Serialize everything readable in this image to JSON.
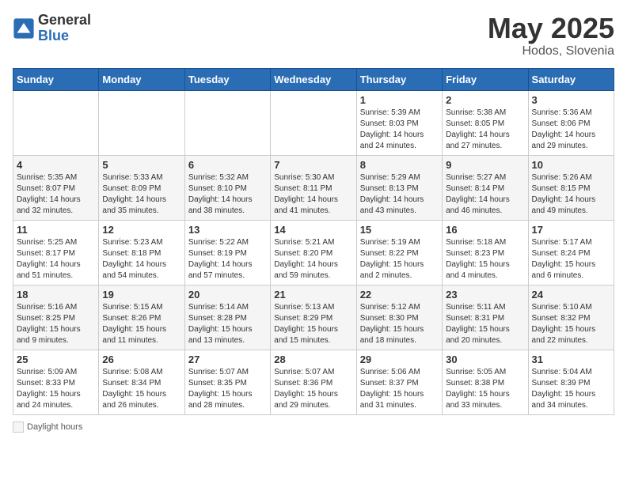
{
  "header": {
    "logo_general": "General",
    "logo_blue": "Blue",
    "month_title": "May 2025",
    "location": "Hodos, Slovenia"
  },
  "days_of_week": [
    "Sunday",
    "Monday",
    "Tuesday",
    "Wednesday",
    "Thursday",
    "Friday",
    "Saturday"
  ],
  "weeks": [
    [
      {
        "day": "",
        "sunrise": "",
        "sunset": "",
        "daylight": ""
      },
      {
        "day": "",
        "sunrise": "",
        "sunset": "",
        "daylight": ""
      },
      {
        "day": "",
        "sunrise": "",
        "sunset": "",
        "daylight": ""
      },
      {
        "day": "",
        "sunrise": "",
        "sunset": "",
        "daylight": ""
      },
      {
        "day": "1",
        "sunrise": "Sunrise: 5:39 AM",
        "sunset": "Sunset: 8:03 PM",
        "daylight": "Daylight: 14 hours and 24 minutes."
      },
      {
        "day": "2",
        "sunrise": "Sunrise: 5:38 AM",
        "sunset": "Sunset: 8:05 PM",
        "daylight": "Daylight: 14 hours and 27 minutes."
      },
      {
        "day": "3",
        "sunrise": "Sunrise: 5:36 AM",
        "sunset": "Sunset: 8:06 PM",
        "daylight": "Daylight: 14 hours and 29 minutes."
      }
    ],
    [
      {
        "day": "4",
        "sunrise": "Sunrise: 5:35 AM",
        "sunset": "Sunset: 8:07 PM",
        "daylight": "Daylight: 14 hours and 32 minutes."
      },
      {
        "day": "5",
        "sunrise": "Sunrise: 5:33 AM",
        "sunset": "Sunset: 8:09 PM",
        "daylight": "Daylight: 14 hours and 35 minutes."
      },
      {
        "day": "6",
        "sunrise": "Sunrise: 5:32 AM",
        "sunset": "Sunset: 8:10 PM",
        "daylight": "Daylight: 14 hours and 38 minutes."
      },
      {
        "day": "7",
        "sunrise": "Sunrise: 5:30 AM",
        "sunset": "Sunset: 8:11 PM",
        "daylight": "Daylight: 14 hours and 41 minutes."
      },
      {
        "day": "8",
        "sunrise": "Sunrise: 5:29 AM",
        "sunset": "Sunset: 8:13 PM",
        "daylight": "Daylight: 14 hours and 43 minutes."
      },
      {
        "day": "9",
        "sunrise": "Sunrise: 5:27 AM",
        "sunset": "Sunset: 8:14 PM",
        "daylight": "Daylight: 14 hours and 46 minutes."
      },
      {
        "day": "10",
        "sunrise": "Sunrise: 5:26 AM",
        "sunset": "Sunset: 8:15 PM",
        "daylight": "Daylight: 14 hours and 49 minutes."
      }
    ],
    [
      {
        "day": "11",
        "sunrise": "Sunrise: 5:25 AM",
        "sunset": "Sunset: 8:17 PM",
        "daylight": "Daylight: 14 hours and 51 minutes."
      },
      {
        "day": "12",
        "sunrise": "Sunrise: 5:23 AM",
        "sunset": "Sunset: 8:18 PM",
        "daylight": "Daylight: 14 hours and 54 minutes."
      },
      {
        "day": "13",
        "sunrise": "Sunrise: 5:22 AM",
        "sunset": "Sunset: 8:19 PM",
        "daylight": "Daylight: 14 hours and 57 minutes."
      },
      {
        "day": "14",
        "sunrise": "Sunrise: 5:21 AM",
        "sunset": "Sunset: 8:20 PM",
        "daylight": "Daylight: 14 hours and 59 minutes."
      },
      {
        "day": "15",
        "sunrise": "Sunrise: 5:19 AM",
        "sunset": "Sunset: 8:22 PM",
        "daylight": "Daylight: 15 hours and 2 minutes."
      },
      {
        "day": "16",
        "sunrise": "Sunrise: 5:18 AM",
        "sunset": "Sunset: 8:23 PM",
        "daylight": "Daylight: 15 hours and 4 minutes."
      },
      {
        "day": "17",
        "sunrise": "Sunrise: 5:17 AM",
        "sunset": "Sunset: 8:24 PM",
        "daylight": "Daylight: 15 hours and 6 minutes."
      }
    ],
    [
      {
        "day": "18",
        "sunrise": "Sunrise: 5:16 AM",
        "sunset": "Sunset: 8:25 PM",
        "daylight": "Daylight: 15 hours and 9 minutes."
      },
      {
        "day": "19",
        "sunrise": "Sunrise: 5:15 AM",
        "sunset": "Sunset: 8:26 PM",
        "daylight": "Daylight: 15 hours and 11 minutes."
      },
      {
        "day": "20",
        "sunrise": "Sunrise: 5:14 AM",
        "sunset": "Sunset: 8:28 PM",
        "daylight": "Daylight: 15 hours and 13 minutes."
      },
      {
        "day": "21",
        "sunrise": "Sunrise: 5:13 AM",
        "sunset": "Sunset: 8:29 PM",
        "daylight": "Daylight: 15 hours and 15 minutes."
      },
      {
        "day": "22",
        "sunrise": "Sunrise: 5:12 AM",
        "sunset": "Sunset: 8:30 PM",
        "daylight": "Daylight: 15 hours and 18 minutes."
      },
      {
        "day": "23",
        "sunrise": "Sunrise: 5:11 AM",
        "sunset": "Sunset: 8:31 PM",
        "daylight": "Daylight: 15 hours and 20 minutes."
      },
      {
        "day": "24",
        "sunrise": "Sunrise: 5:10 AM",
        "sunset": "Sunset: 8:32 PM",
        "daylight": "Daylight: 15 hours and 22 minutes."
      }
    ],
    [
      {
        "day": "25",
        "sunrise": "Sunrise: 5:09 AM",
        "sunset": "Sunset: 8:33 PM",
        "daylight": "Daylight: 15 hours and 24 minutes."
      },
      {
        "day": "26",
        "sunrise": "Sunrise: 5:08 AM",
        "sunset": "Sunset: 8:34 PM",
        "daylight": "Daylight: 15 hours and 26 minutes."
      },
      {
        "day": "27",
        "sunrise": "Sunrise: 5:07 AM",
        "sunset": "Sunset: 8:35 PM",
        "daylight": "Daylight: 15 hours and 28 minutes."
      },
      {
        "day": "28",
        "sunrise": "Sunrise: 5:07 AM",
        "sunset": "Sunset: 8:36 PM",
        "daylight": "Daylight: 15 hours and 29 minutes."
      },
      {
        "day": "29",
        "sunrise": "Sunrise: 5:06 AM",
        "sunset": "Sunset: 8:37 PM",
        "daylight": "Daylight: 15 hours and 31 minutes."
      },
      {
        "day": "30",
        "sunrise": "Sunrise: 5:05 AM",
        "sunset": "Sunset: 8:38 PM",
        "daylight": "Daylight: 15 hours and 33 minutes."
      },
      {
        "day": "31",
        "sunrise": "Sunrise: 5:04 AM",
        "sunset": "Sunset: 8:39 PM",
        "daylight": "Daylight: 15 hours and 34 minutes."
      }
    ]
  ],
  "footer": {
    "daylight_label": "Daylight hours"
  }
}
